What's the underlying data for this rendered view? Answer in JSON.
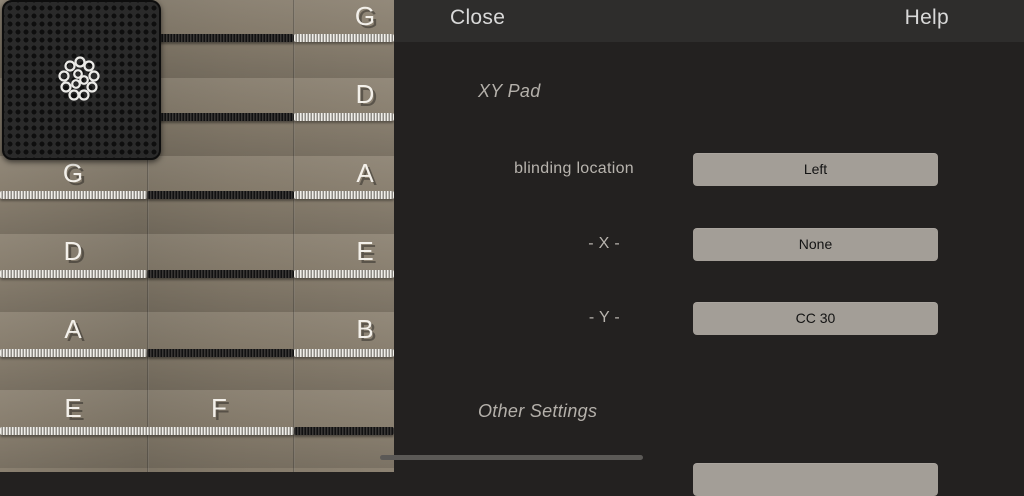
{
  "fretboard": {
    "note_labels": [
      "G",
      "D",
      "G",
      "A",
      "D",
      "E",
      "A",
      "B",
      "E",
      "F"
    ]
  },
  "header": {
    "close_label": "Close",
    "help_label": "Help"
  },
  "xy_pad_section": {
    "title": "XY Pad",
    "rows": [
      {
        "label": "blinding location",
        "value": "Left"
      },
      {
        "label": "- X -",
        "value": "None"
      },
      {
        "label": "- Y -",
        "value": "CC 30"
      }
    ]
  },
  "other_settings_section": {
    "title": "Other Settings"
  },
  "colors": {
    "panel_bg": "#232120",
    "topbar_bg": "#2e2d2c",
    "value_button_bg": "#a39e97",
    "fretboard_wood": "#857b6b"
  },
  "icons": {
    "xy_pad_cursor": "xy-cursor-icon"
  }
}
